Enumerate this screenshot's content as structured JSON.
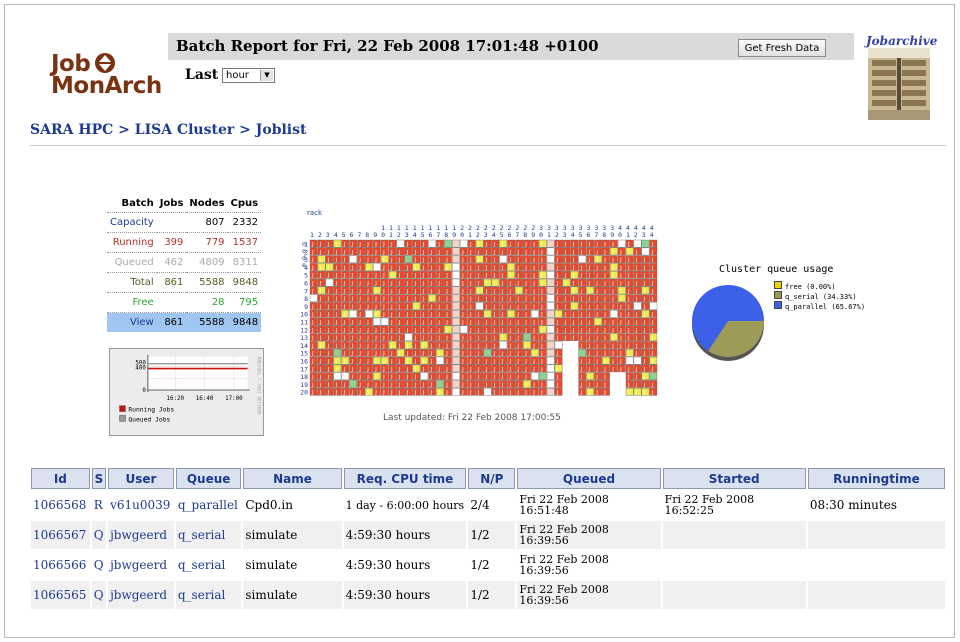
{
  "app": {
    "logo_line1": "Job",
    "logo_line2": "MonArch",
    "report_title": "Batch Report for Fri, 22 Feb 2008 17:01:48 +0100",
    "fresh_button": "Get Fresh Data",
    "last_label": "Last",
    "range_value": "hour",
    "archive_title": "Jobarchive"
  },
  "breadcrumb": {
    "site": "SARA HPC",
    "sep1": " > ",
    "cluster": "LISA Cluster",
    "sep2": " > ",
    "page": "Joblist"
  },
  "stats": {
    "headers": [
      "Batch",
      "Jobs",
      "Nodes",
      "Cpus"
    ],
    "rows": [
      {
        "label": "Capacity",
        "jobs": "",
        "nodes": "807",
        "cpus": "2332"
      },
      {
        "label": "Running",
        "jobs": "399",
        "nodes": "779",
        "cpus": "1537"
      },
      {
        "label": "Queued",
        "jobs": "462",
        "nodes": "4809",
        "cpus": "8311"
      },
      {
        "label": "Total",
        "jobs": "861",
        "nodes": "5588",
        "cpus": "9848"
      },
      {
        "label": "Free",
        "jobs": "",
        "nodes": "28",
        "cpus": "795"
      },
      {
        "label": "View",
        "jobs": "861",
        "nodes": "5588",
        "cpus": "9848"
      }
    ]
  },
  "graph": {
    "y_ticks": [
      "500",
      "400",
      "0"
    ],
    "x_ticks": [
      "16:20",
      "16:40",
      "17:00"
    ],
    "legend_running": "Running Jobs",
    "legend_queued": "Queued Jobs",
    "side_text": "RRDTOOL / TOBI OETIKER",
    "running_level": 400,
    "queued_level": 460,
    "colors": {
      "running": "#cc1111",
      "queued": "#999999"
    }
  },
  "rack": {
    "label": "rack",
    "node_label": "node",
    "rack_count": 44,
    "node_count": 20,
    "colors": {
      "busy": "#e64a2e",
      "partial": "#f2ea4a",
      "free": "#ffffff",
      "green": "#8fd18f"
    }
  },
  "queue_usage": {
    "title": "Cluster queue usage",
    "slices": [
      {
        "label": "free (0.00%)",
        "value": 0.0,
        "color": "#f0d000"
      },
      {
        "label": "q_serial (34.33%)",
        "value": 34.33,
        "color": "#9c9c58"
      },
      {
        "label": "q_parallel (65.67%)",
        "value": 65.67,
        "color": "#3c60e8"
      }
    ]
  },
  "last_updated": "Last updated: Fri 22 Feb 2008 17:00:55",
  "jobs": {
    "columns": [
      "Id",
      "S",
      "User",
      "Queue",
      "Name",
      "Req. CPU time",
      "N/P",
      "Queued",
      "Started",
      "Runningtime"
    ],
    "rows": [
      {
        "id": "1066568",
        "s": "R",
        "user": "v61u0039",
        "queue": "q_parallel",
        "name": "Cpd0.in",
        "cpu": "1 day - 6:00:00 hours",
        "np": "2/4",
        "queued": "Fri 22 Feb 2008 16:51:48",
        "started": "Fri 22 Feb 2008 16:52:25",
        "running": "08:30 minutes"
      },
      {
        "id": "1066567",
        "s": "Q",
        "user": "jbwgeerd",
        "queue": "q_serial",
        "name": "simulate",
        "cpu": "4:59:30 hours",
        "np": "1/2",
        "queued": "Fri 22 Feb 2008 16:39:56",
        "started": "",
        "running": ""
      },
      {
        "id": "1066566",
        "s": "Q",
        "user": "jbwgeerd",
        "queue": "q_serial",
        "name": "simulate",
        "cpu": "4:59:30 hours",
        "np": "1/2",
        "queued": "Fri 22 Feb 2008 16:39:56",
        "started": "",
        "running": ""
      },
      {
        "id": "1066565",
        "s": "Q",
        "user": "jbwgeerd",
        "queue": "q_serial",
        "name": "simulate",
        "cpu": "4:59:30 hours",
        "np": "1/2",
        "queued": "Fri 22 Feb 2008 16:39:56",
        "started": "",
        "running": ""
      }
    ]
  }
}
